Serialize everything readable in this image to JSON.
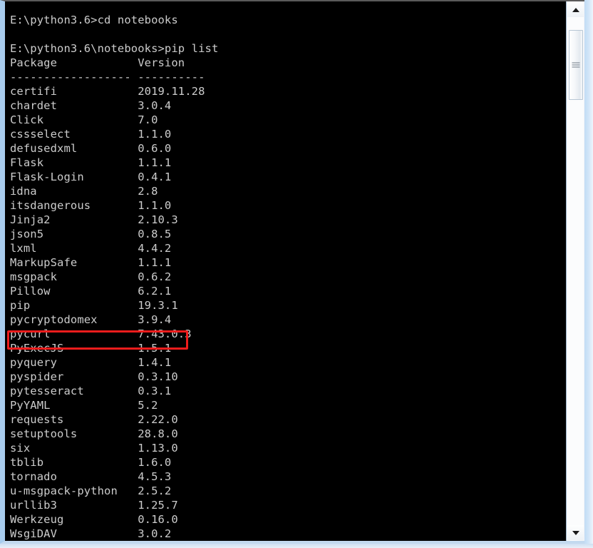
{
  "window": {
    "kind": "windows-command-prompt",
    "background_color": "#000000",
    "text_color": "#cccccc"
  },
  "terminal": {
    "lines": [
      "E:\\python3.6>cd notebooks",
      "",
      "E:\\python3.6\\notebooks>pip list",
      "Package            Version",
      "------------------ ----------",
      "certifi            2019.11.28",
      "chardet            3.0.4",
      "Click              7.0",
      "cssselect          1.1.0",
      "defusedxml         0.6.0",
      "Flask              1.1.1",
      "Flask-Login        0.4.1",
      "idna               2.8",
      "itsdangerous       1.1.0",
      "Jinja2             2.10.3",
      "json5              0.8.5",
      "lxml               4.4.2",
      "MarkupSafe         1.1.1",
      "msgpack            0.6.2",
      "Pillow             6.2.1",
      "pip                19.3.1",
      "pycryptodomex      3.9.4",
      "pycurl             7.43.0.3",
      "PyExecJS           1.5.1",
      "pyquery            1.4.1",
      "pyspider           0.3.10",
      "pytesseract        0.3.1",
      "PyYAML             5.2",
      "requests           2.22.0",
      "setuptools         28.8.0",
      "six                1.13.0",
      "tblib              1.6.0",
      "tornado            4.5.3",
      "u-msgpack-python   2.5.2",
      "urllib3            1.25.7",
      "Werkzeug           0.16.0",
      "WsgiDAV            3.0.2"
    ],
    "commands": [
      "cd notebooks",
      "pip list"
    ],
    "prompts": [
      "E:\\python3.6>",
      "E:\\python3.6\\notebooks>"
    ],
    "table": {
      "headers": [
        "Package",
        "Version"
      ],
      "separator": "------------------ ----------",
      "rows": [
        [
          "certifi",
          "2019.11.28"
        ],
        [
          "chardet",
          "3.0.4"
        ],
        [
          "Click",
          "7.0"
        ],
        [
          "cssselect",
          "1.1.0"
        ],
        [
          "defusedxml",
          "0.6.0"
        ],
        [
          "Flask",
          "1.1.1"
        ],
        [
          "Flask-Login",
          "0.4.1"
        ],
        [
          "idna",
          "2.8"
        ],
        [
          "itsdangerous",
          "1.1.0"
        ],
        [
          "Jinja2",
          "2.10.3"
        ],
        [
          "json5",
          "0.8.5"
        ],
        [
          "lxml",
          "4.4.2"
        ],
        [
          "MarkupSafe",
          "1.1.1"
        ],
        [
          "msgpack",
          "0.6.2"
        ],
        [
          "Pillow",
          "6.2.1"
        ],
        [
          "pip",
          "19.3.1"
        ],
        [
          "pycryptodomex",
          "3.9.4"
        ],
        [
          "pycurl",
          "7.43.0.3"
        ],
        [
          "PyExecJS",
          "1.5.1"
        ],
        [
          "pyquery",
          "1.4.1"
        ],
        [
          "pyspider",
          "0.3.10"
        ],
        [
          "pytesseract",
          "0.3.1"
        ],
        [
          "PyYAML",
          "5.2"
        ],
        [
          "requests",
          "2.22.0"
        ],
        [
          "setuptools",
          "28.8.0"
        ],
        [
          "six",
          "1.13.0"
        ],
        [
          "tblib",
          "1.6.0"
        ],
        [
          "tornado",
          "4.5.3"
        ],
        [
          "u-msgpack-python",
          "2.5.2"
        ],
        [
          "urllib3",
          "1.25.7"
        ],
        [
          "Werkzeug",
          "0.16.0"
        ],
        [
          "WsgiDAV",
          "3.0.2"
        ]
      ]
    }
  },
  "annotation": {
    "type": "rectangle",
    "color": "#ee1c1c",
    "target_package": "PyExecJS",
    "target_version": "1.5.1"
  },
  "scrollbar": {
    "orientation": "vertical",
    "up_arrow": "▲",
    "down_arrow": "▼"
  }
}
